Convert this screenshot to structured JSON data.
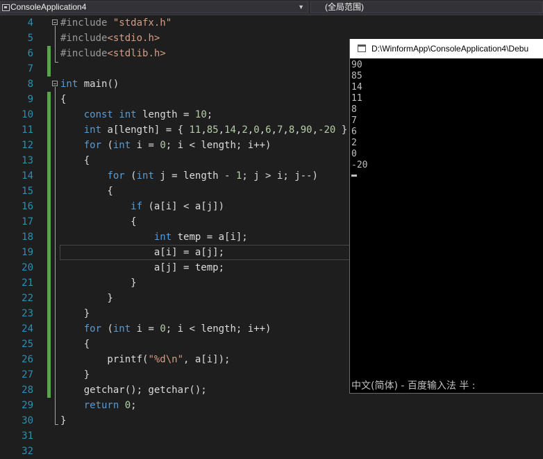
{
  "navbar": {
    "project": "ConsoleApplication4",
    "scope": "(全局范围)"
  },
  "editor": {
    "lines": [
      {
        "n": "4",
        "t": [
          [
            "pp",
            "#include "
          ],
          [
            "str",
            "\"stdafx.h\""
          ]
        ]
      },
      {
        "n": "5",
        "t": [
          [
            "pp",
            "#include"
          ],
          [
            "str",
            "<stdio.h>"
          ]
        ]
      },
      {
        "n": "6",
        "t": [
          [
            "pp",
            "#include"
          ],
          [
            "str",
            "<stdlib.h>"
          ]
        ]
      },
      {
        "n": "7",
        "t": []
      },
      {
        "n": "8",
        "t": [
          [
            "kw",
            "int"
          ],
          [
            "txt",
            " main()"
          ]
        ]
      },
      {
        "n": "9",
        "t": [
          [
            "txt",
            "{"
          ]
        ]
      },
      {
        "n": "10",
        "t": [
          [
            "txt",
            "    "
          ],
          [
            "kw",
            "const"
          ],
          [
            "txt",
            " "
          ],
          [
            "kw",
            "int"
          ],
          [
            "txt",
            " length = "
          ],
          [
            "num",
            "10"
          ],
          [
            "txt",
            ";"
          ]
        ]
      },
      {
        "n": "11",
        "t": [
          [
            "txt",
            "    "
          ],
          [
            "kw",
            "int"
          ],
          [
            "txt",
            " a[length] = { "
          ],
          [
            "num",
            "11"
          ],
          [
            "txt",
            ","
          ],
          [
            "num",
            "85"
          ],
          [
            "txt",
            ","
          ],
          [
            "num",
            "14"
          ],
          [
            "txt",
            ","
          ],
          [
            "num",
            "2"
          ],
          [
            "txt",
            ","
          ],
          [
            "num",
            "0"
          ],
          [
            "txt",
            ","
          ],
          [
            "num",
            "6"
          ],
          [
            "txt",
            ","
          ],
          [
            "num",
            "7"
          ],
          [
            "txt",
            ","
          ],
          [
            "num",
            "8"
          ],
          [
            "txt",
            ","
          ],
          [
            "num",
            "90"
          ],
          [
            "txt",
            ","
          ],
          [
            "num",
            "-20"
          ],
          [
            "txt",
            " };"
          ]
        ]
      },
      {
        "n": "12",
        "t": [
          [
            "txt",
            "    "
          ],
          [
            "kw",
            "for"
          ],
          [
            "txt",
            " ("
          ],
          [
            "kw",
            "int"
          ],
          [
            "txt",
            " i = "
          ],
          [
            "num",
            "0"
          ],
          [
            "txt",
            "; i < length; i++)"
          ]
        ]
      },
      {
        "n": "13",
        "t": [
          [
            "txt",
            "    {"
          ]
        ]
      },
      {
        "n": "14",
        "t": [
          [
            "txt",
            "        "
          ],
          [
            "kw",
            "for"
          ],
          [
            "txt",
            " ("
          ],
          [
            "kw",
            "int"
          ],
          [
            "txt",
            " j = length - "
          ],
          [
            "num",
            "1"
          ],
          [
            "txt",
            "; j > i; j--)"
          ]
        ]
      },
      {
        "n": "15",
        "t": [
          [
            "txt",
            "        {"
          ]
        ]
      },
      {
        "n": "16",
        "t": [
          [
            "txt",
            "            "
          ],
          [
            "kw",
            "if"
          ],
          [
            "txt",
            " (a[i] < a[j])"
          ]
        ]
      },
      {
        "n": "17",
        "t": [
          [
            "txt",
            "            {"
          ]
        ]
      },
      {
        "n": "18",
        "t": [
          [
            "txt",
            "                "
          ],
          [
            "kw",
            "int"
          ],
          [
            "txt",
            " temp = a[i];"
          ]
        ]
      },
      {
        "n": "19",
        "t": [
          [
            "txt",
            "                a[i] = a[j];"
          ]
        ]
      },
      {
        "n": "20",
        "t": [
          [
            "txt",
            "                a[j] = temp;"
          ]
        ]
      },
      {
        "n": "21",
        "t": [
          [
            "txt",
            "            }"
          ]
        ]
      },
      {
        "n": "22",
        "t": [
          [
            "txt",
            "        }"
          ]
        ]
      },
      {
        "n": "23",
        "t": [
          [
            "txt",
            "    }"
          ]
        ]
      },
      {
        "n": "24",
        "t": [
          [
            "txt",
            "    "
          ],
          [
            "kw",
            "for"
          ],
          [
            "txt",
            " ("
          ],
          [
            "kw",
            "int"
          ],
          [
            "txt",
            " i = "
          ],
          [
            "num",
            "0"
          ],
          [
            "txt",
            "; i < length; i++)"
          ]
        ]
      },
      {
        "n": "25",
        "t": [
          [
            "txt",
            "    {"
          ]
        ]
      },
      {
        "n": "26",
        "t": [
          [
            "txt",
            "        printf("
          ],
          [
            "str",
            "\"%d\\n\""
          ],
          [
            "txt",
            ", a[i]);"
          ]
        ]
      },
      {
        "n": "27",
        "t": [
          [
            "txt",
            "    }"
          ]
        ]
      },
      {
        "n": "28",
        "t": [
          [
            "txt",
            "    getchar(); getchar();"
          ]
        ]
      },
      {
        "n": "29",
        "t": [
          [
            "txt",
            "    "
          ],
          [
            "kw",
            "return"
          ],
          [
            "txt",
            " "
          ],
          [
            "num",
            "0"
          ],
          [
            "txt",
            ";"
          ]
        ]
      },
      {
        "n": "30",
        "t": [
          [
            "txt",
            "}"
          ]
        ]
      },
      {
        "n": "31",
        "t": []
      },
      {
        "n": "32",
        "t": []
      }
    ]
  },
  "console": {
    "title": "D:\\WinformApp\\ConsoleApplication4\\Debu",
    "output": [
      "90",
      "85",
      "14",
      "11",
      "8",
      "7",
      "6",
      "2",
      "0",
      "-20"
    ],
    "ime_status": "中文(简体) - 百度输入法 半 :"
  }
}
